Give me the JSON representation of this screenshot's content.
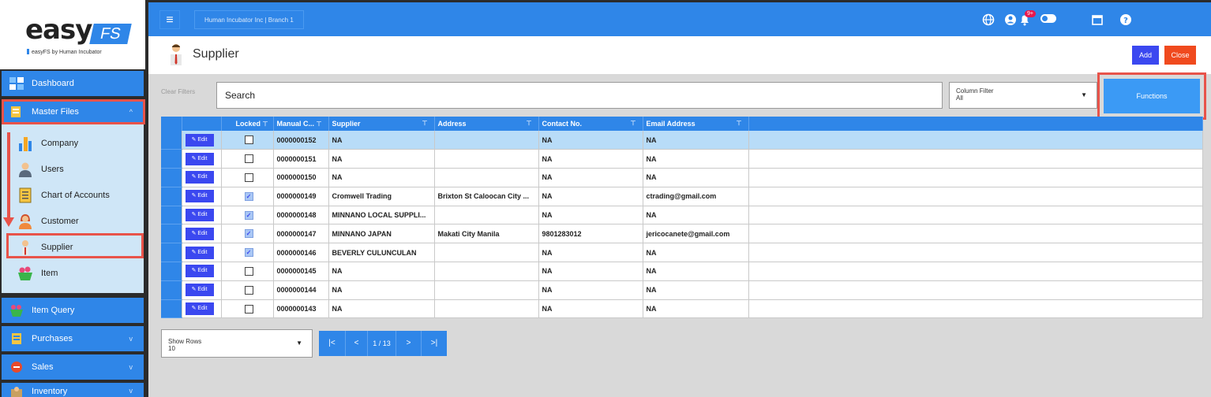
{
  "logo": {
    "main": "easy",
    "badge": "FS",
    "subtitle": "easyFS by Human Incubator"
  },
  "sidebar": {
    "items": [
      {
        "label": "Dashboard",
        "icon": "dashboard-icon"
      },
      {
        "label": "Master Files",
        "icon": "folder-icon"
      },
      {
        "label": "Item Query",
        "icon": "basket-icon"
      },
      {
        "label": "Purchases",
        "icon": "purchases-icon"
      },
      {
        "label": "Sales",
        "icon": "sale-tag-icon"
      },
      {
        "label": "Inventory",
        "icon": "inventory-icon"
      }
    ],
    "submenu": [
      {
        "label": "Company",
        "icon": "building-icon"
      },
      {
        "label": "Users",
        "icon": "user-icon"
      },
      {
        "label": "Chart of Accounts",
        "icon": "ledger-icon"
      },
      {
        "label": "Customer",
        "icon": "customer-icon"
      },
      {
        "label": "Supplier",
        "icon": "supplier-icon"
      },
      {
        "label": "Item",
        "icon": "basket-icon"
      }
    ]
  },
  "topbar": {
    "company": "Human Incubator Inc | Branch 1",
    "notification_count": "9+"
  },
  "page": {
    "title": "Supplier",
    "add_label": "Add",
    "close_label": "Close"
  },
  "filters": {
    "clear_label": "Clear Filters",
    "search_value": "Search",
    "column_filter_label": "Column Filter",
    "column_filter_value": "All",
    "functions_label": "Functions"
  },
  "table": {
    "edit_label": "Edit",
    "headers": [
      "Locked",
      "Manual C...",
      "Supplier",
      "Address",
      "Contact No.",
      "Email Address"
    ],
    "rows": [
      {
        "locked": false,
        "code": "0000000152",
        "supplier": "NA",
        "address": "",
        "contact": "NA",
        "email": "NA"
      },
      {
        "locked": false,
        "code": "0000000151",
        "supplier": "NA",
        "address": "",
        "contact": "NA",
        "email": "NA"
      },
      {
        "locked": false,
        "code": "0000000150",
        "supplier": "NA",
        "address": "",
        "contact": "NA",
        "email": "NA"
      },
      {
        "locked": true,
        "code": "0000000149",
        "supplier": "Cromwell Trading",
        "address": "Brixton St Caloocan City ...",
        "contact": "NA",
        "email": "ctrading@gmail.com"
      },
      {
        "locked": true,
        "code": "0000000148",
        "supplier": "MINNANO LOCAL SUPPLI...",
        "address": "",
        "contact": "NA",
        "email": "NA"
      },
      {
        "locked": true,
        "code": "0000000147",
        "supplier": "MINNANO JAPAN",
        "address": "Makati City Manila",
        "contact": "9801283012",
        "email": "jericocanete@gmail.com"
      },
      {
        "locked": true,
        "code": "0000000146",
        "supplier": "BEVERLY CULUNCULAN",
        "address": "",
        "contact": "NA",
        "email": "NA"
      },
      {
        "locked": false,
        "code": "0000000145",
        "supplier": "NA",
        "address": "",
        "contact": "NA",
        "email": "NA"
      },
      {
        "locked": false,
        "code": "0000000144",
        "supplier": "NA",
        "address": "",
        "contact": "NA",
        "email": "NA"
      },
      {
        "locked": false,
        "code": "0000000143",
        "supplier": "NA",
        "address": "",
        "contact": "NA",
        "email": "NA"
      }
    ]
  },
  "pagination": {
    "show_rows_label": "Show Rows",
    "show_rows_value": "10",
    "page_indicator": "1 / 13"
  },
  "colors": {
    "primary": "#2f86e8",
    "accent_button": "#3b48f0",
    "danger": "#f04a1e",
    "highlight": "#e8534a",
    "selected_row": "#b8dcf8"
  }
}
